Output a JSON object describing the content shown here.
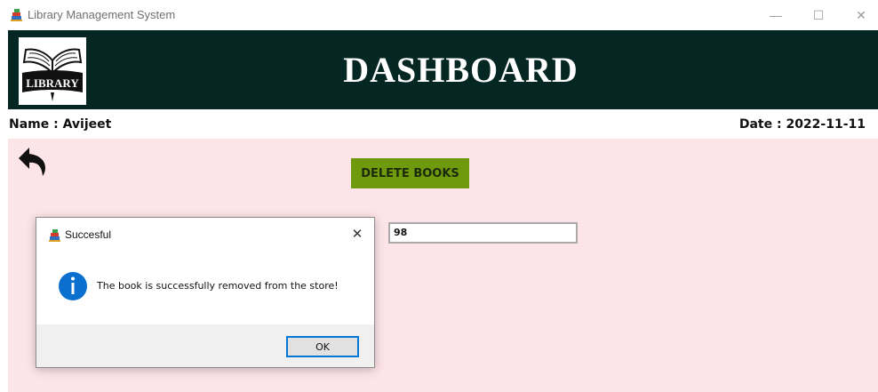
{
  "window": {
    "title": "Library Management System",
    "minimize_glyph": "—",
    "maximize_glyph": "☐",
    "close_glyph": "✕"
  },
  "header": {
    "logo_text": "LIBRARY",
    "title": "DASHBOARD"
  },
  "info": {
    "name_text": "Name :  Avijeet",
    "date_text": "Date :  2022-11-11"
  },
  "main": {
    "delete_button_label": "DELETE BOOKS",
    "book_id_value": "98"
  },
  "dialog": {
    "title": "Succesful",
    "message": "The book is successfully removed from the store!",
    "ok_label": "OK",
    "close_glyph": "✕"
  },
  "colors": {
    "header_bg": "#042724",
    "main_bg": "#fde4e8",
    "delete_button_bg": "#709a0e",
    "ok_button_border": "#0078d7",
    "info_icon": "#0a6fce"
  },
  "icons": {
    "app_icon": "app-books-icon",
    "logo": "library-book-logo",
    "back": "back-arrow-icon",
    "info": "information-icon"
  }
}
